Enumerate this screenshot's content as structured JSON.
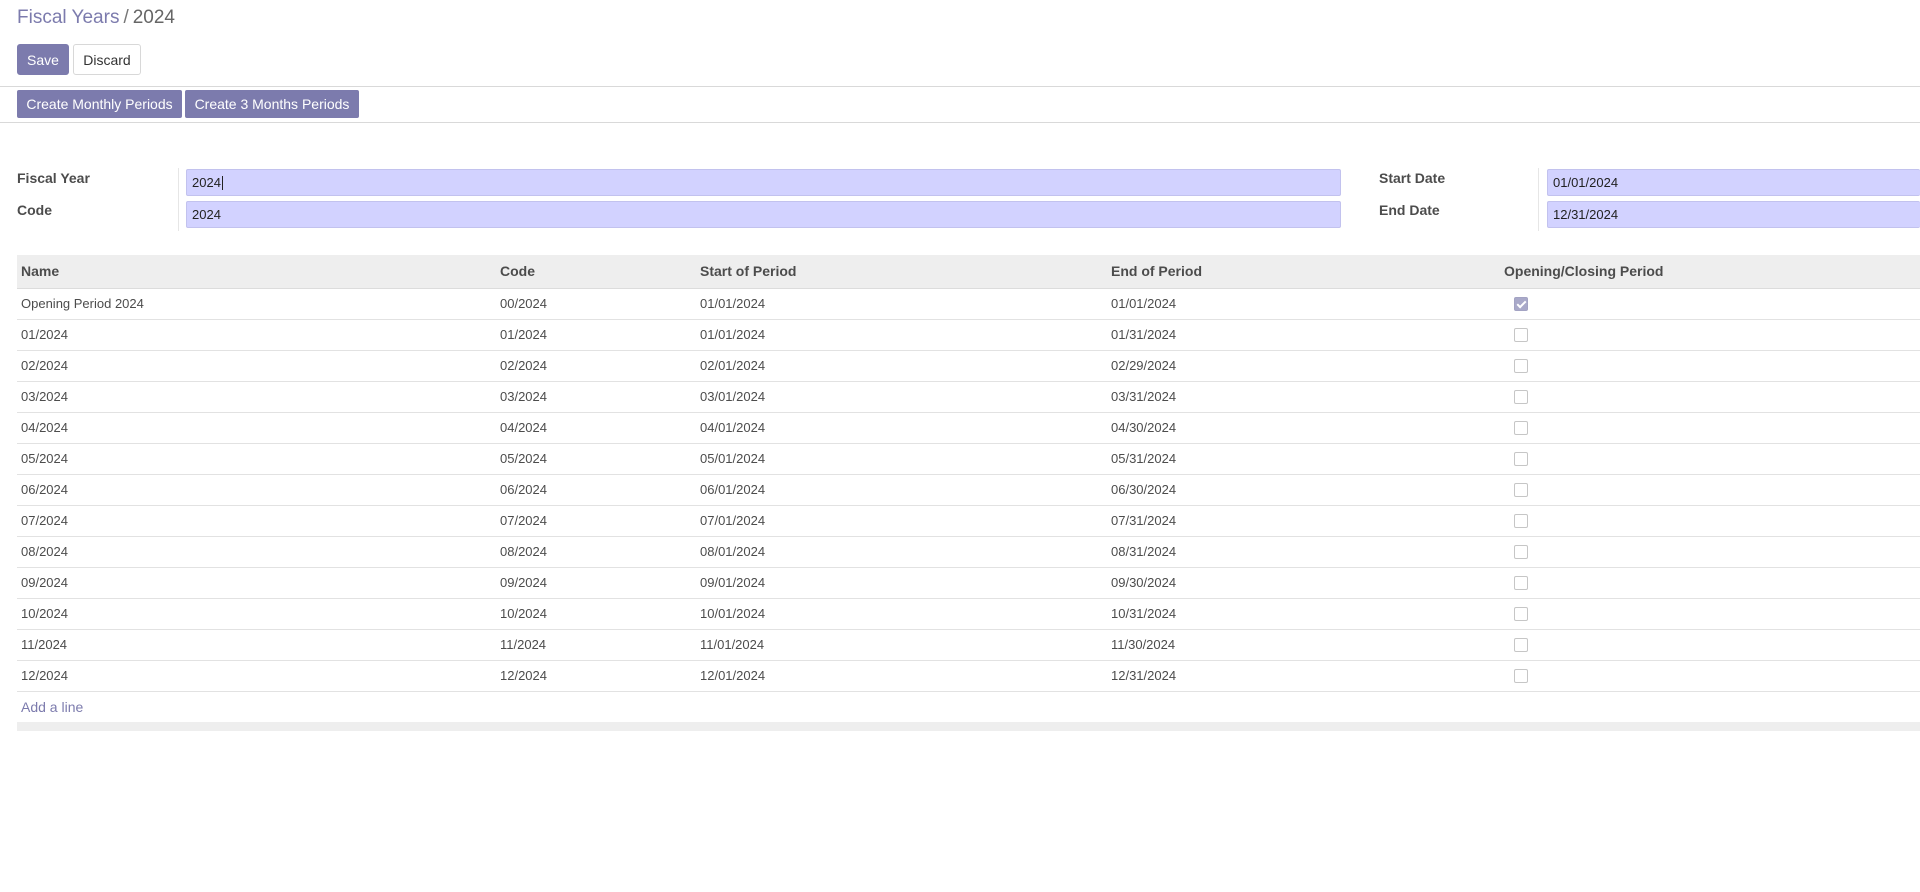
{
  "breadcrumb": {
    "parent": "Fiscal Years",
    "separator": "/",
    "current": "2024"
  },
  "actions": {
    "save_label": "Save",
    "discard_label": "Discard"
  },
  "header_buttons": {
    "monthly_label": "Create Monthly Periods",
    "quarterly_label": "Create 3 Months Periods"
  },
  "form": {
    "fiscal_year_label": "Fiscal Year",
    "fiscal_year_value": "2024",
    "code_label": "Code",
    "code_value": "2024",
    "start_date_label": "Start Date",
    "start_date_value": "01/01/2024",
    "end_date_label": "End Date",
    "end_date_value": "12/31/2024"
  },
  "periods": {
    "columns": [
      "Name",
      "Code",
      "Start of Period",
      "End of Period",
      "Opening/Closing Period"
    ],
    "rows": [
      {
        "name": "Opening Period 2024",
        "code": "00/2024",
        "start": "01/01/2024",
        "end": "01/01/2024",
        "opening": true
      },
      {
        "name": "01/2024",
        "code": "01/2024",
        "start": "01/01/2024",
        "end": "01/31/2024",
        "opening": false
      },
      {
        "name": "02/2024",
        "code": "02/2024",
        "start": "02/01/2024",
        "end": "02/29/2024",
        "opening": false
      },
      {
        "name": "03/2024",
        "code": "03/2024",
        "start": "03/01/2024",
        "end": "03/31/2024",
        "opening": false
      },
      {
        "name": "04/2024",
        "code": "04/2024",
        "start": "04/01/2024",
        "end": "04/30/2024",
        "opening": false
      },
      {
        "name": "05/2024",
        "code": "05/2024",
        "start": "05/01/2024",
        "end": "05/31/2024",
        "opening": false
      },
      {
        "name": "06/2024",
        "code": "06/2024",
        "start": "06/01/2024",
        "end": "06/30/2024",
        "opening": false
      },
      {
        "name": "07/2024",
        "code": "07/2024",
        "start": "07/01/2024",
        "end": "07/31/2024",
        "opening": false
      },
      {
        "name": "08/2024",
        "code": "08/2024",
        "start": "08/01/2024",
        "end": "08/31/2024",
        "opening": false
      },
      {
        "name": "09/2024",
        "code": "09/2024",
        "start": "09/01/2024",
        "end": "09/30/2024",
        "opening": false
      },
      {
        "name": "10/2024",
        "code": "10/2024",
        "start": "10/01/2024",
        "end": "10/31/2024",
        "opening": false
      },
      {
        "name": "11/2024",
        "code": "11/2024",
        "start": "11/01/2024",
        "end": "11/30/2024",
        "opening": false
      },
      {
        "name": "12/2024",
        "code": "12/2024",
        "start": "12/01/2024",
        "end": "12/31/2024",
        "opening": false
      }
    ],
    "add_line_label": "Add a line"
  },
  "colors": {
    "accent": "#7c7bad",
    "input_bg": "#d2d2ff",
    "header_bg": "#eeeeee"
  }
}
